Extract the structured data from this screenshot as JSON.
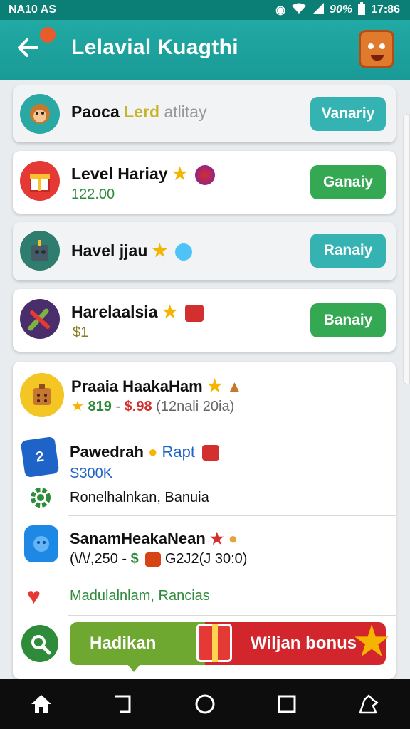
{
  "status_bar": {
    "carrier": "NA10 AS",
    "battery": "90%",
    "time": "17:86"
  },
  "app_bar": {
    "title": "Lelavial Kuagthi"
  },
  "cards": [
    {
      "title": "Paoca",
      "title_extra_1": "Lerd",
      "title_extra_2": "atlitay",
      "button": "Vanariy",
      "button_color": "#34b3b2"
    },
    {
      "title": "Level Hariay",
      "subtitle": "122.00",
      "button": "Ganaiy",
      "button_color": "#34a853"
    },
    {
      "title": "Havel  jjau",
      "button": "Ranaiy",
      "button_color": "#34b3b2"
    },
    {
      "title": "Harelaalsia",
      "subtitle": "$1",
      "button": "Banaiy",
      "button_color": "#34a853"
    }
  ],
  "list": [
    {
      "title": "Praaia HaakaHam",
      "sub_a": "819",
      "sub_b": "$.98",
      "sub_c": "(12nali 20ia)"
    },
    {
      "title": "Pawedrah",
      "title_extra": "Rapt",
      "subtitle": "S300K"
    },
    {
      "title": "Ronelhalnkan, Banuia"
    },
    {
      "title": "SanamHeakaNean",
      "sub_a": "(\\/\\/,250",
      "sub_b": "$",
      "sub_c": "G2J2(J 30:0)"
    },
    {
      "title": "Madulalnlam, Rancias"
    }
  ],
  "promo": {
    "left_label": "Hadikan",
    "right_label": "Wiljan bonus"
  },
  "colors": {
    "teal": "#21aaa5",
    "green": "#34a853",
    "red": "#d3262c"
  }
}
